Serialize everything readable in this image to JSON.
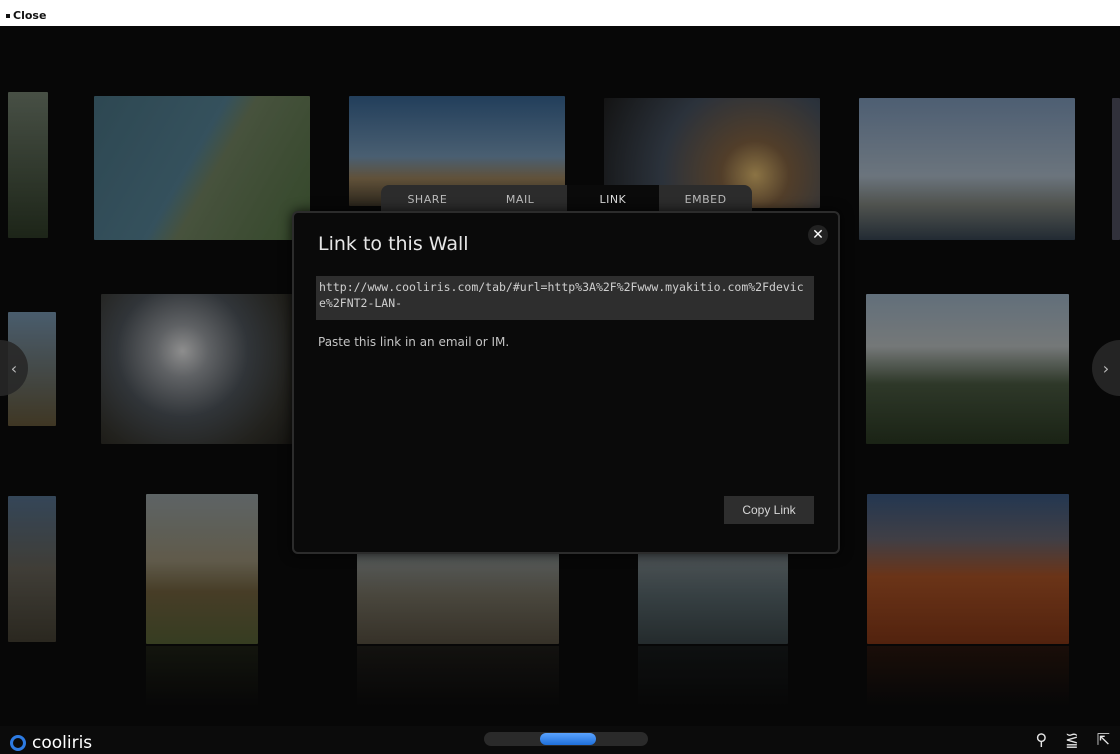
{
  "close_label": "Close",
  "tabs": [
    "SHARE",
    "MAIL",
    "LINK",
    "EMBED"
  ],
  "dialog": {
    "title": "Link to this Wall",
    "link": "http://www.cooliris.com/tab/#url=http%3A%2F%2Fwww.myakitio.com%2Fdevice%2FNT2-LAN-",
    "hint": "Paste this link in an email or IM.",
    "copy_label": "Copy Link"
  },
  "brand": "cooliris",
  "colors": {
    "accent": "#2d7be3",
    "background": "#0b0b0b",
    "panel": "#2e2e2e"
  },
  "icons": [
    "search-icon",
    "share-icon",
    "fullscreen-icon"
  ]
}
